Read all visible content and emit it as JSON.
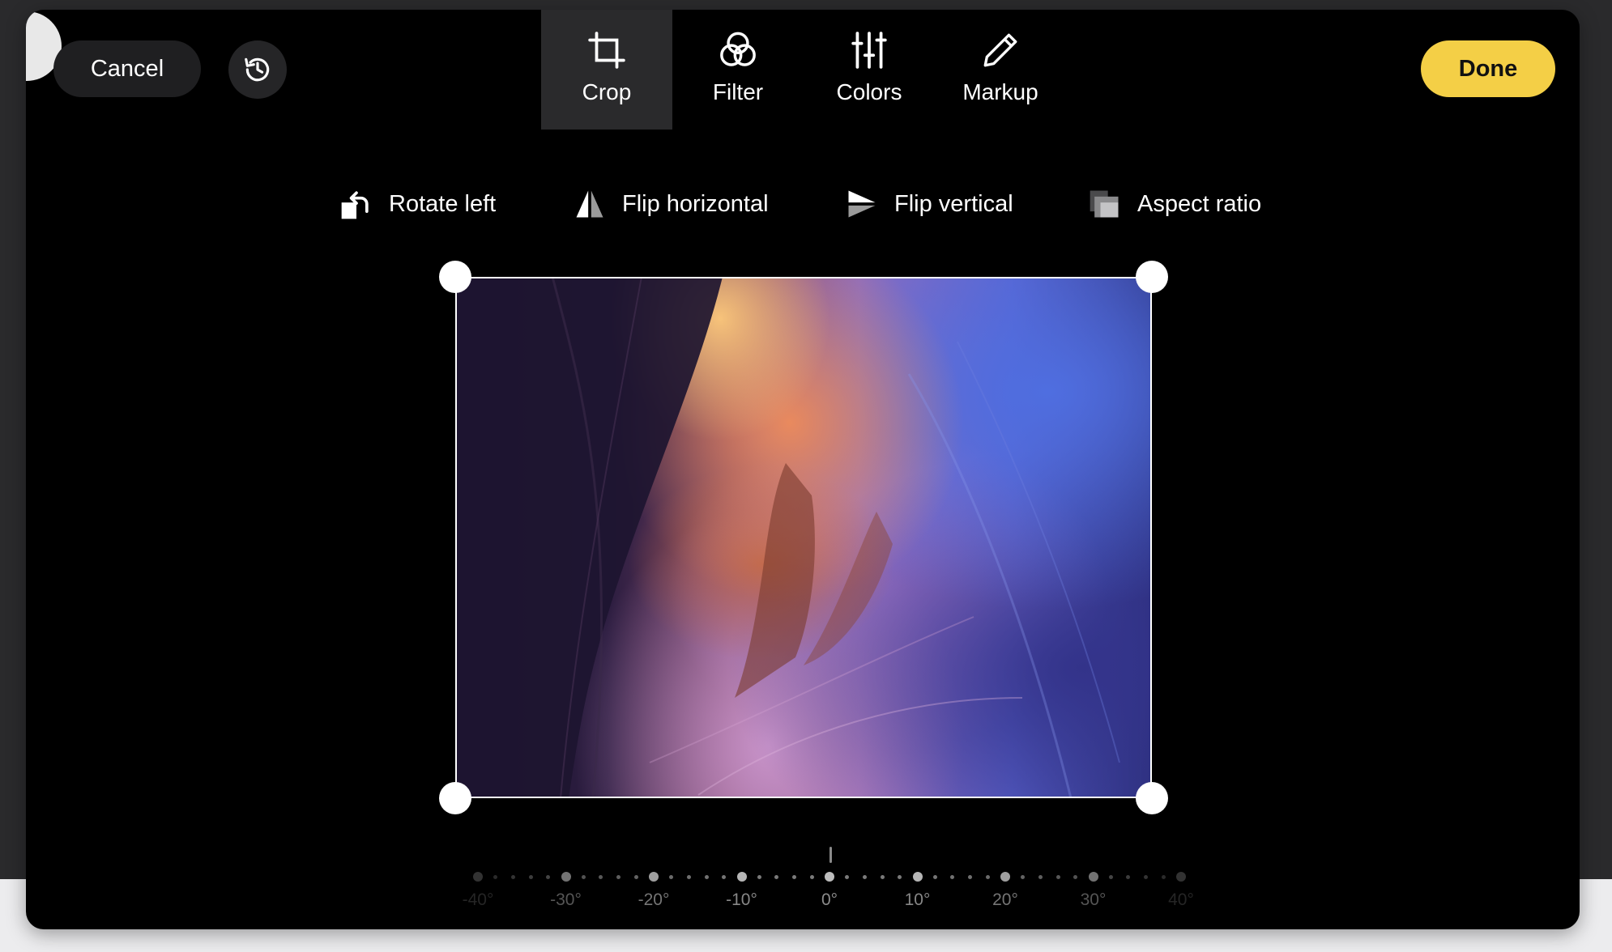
{
  "header": {
    "cancel_label": "Cancel",
    "done_label": "Done",
    "history_icon": "history-icon"
  },
  "tabs": [
    {
      "label": "Crop",
      "icon": "crop-icon",
      "active": true
    },
    {
      "label": "Filter",
      "icon": "filter-icon",
      "active": false
    },
    {
      "label": "Colors",
      "icon": "sliders-icon",
      "active": false
    },
    {
      "label": "Markup",
      "icon": "pencil-icon",
      "active": false
    }
  ],
  "tools": {
    "rotate_left": "Rotate left",
    "flip_horizontal": "Flip horizontal",
    "flip_vertical": "Flip vertical",
    "aspect_ratio": "Aspect ratio"
  },
  "dial": {
    "value": "0°",
    "labels": [
      "-40°",
      "-30°",
      "-20°",
      "-10°",
      "0°",
      "10°",
      "20°",
      "30°",
      "40°"
    ]
  },
  "colors": {
    "accent": "#f4cf46",
    "background": "#000000",
    "active_tab": "#2a2a2c"
  }
}
